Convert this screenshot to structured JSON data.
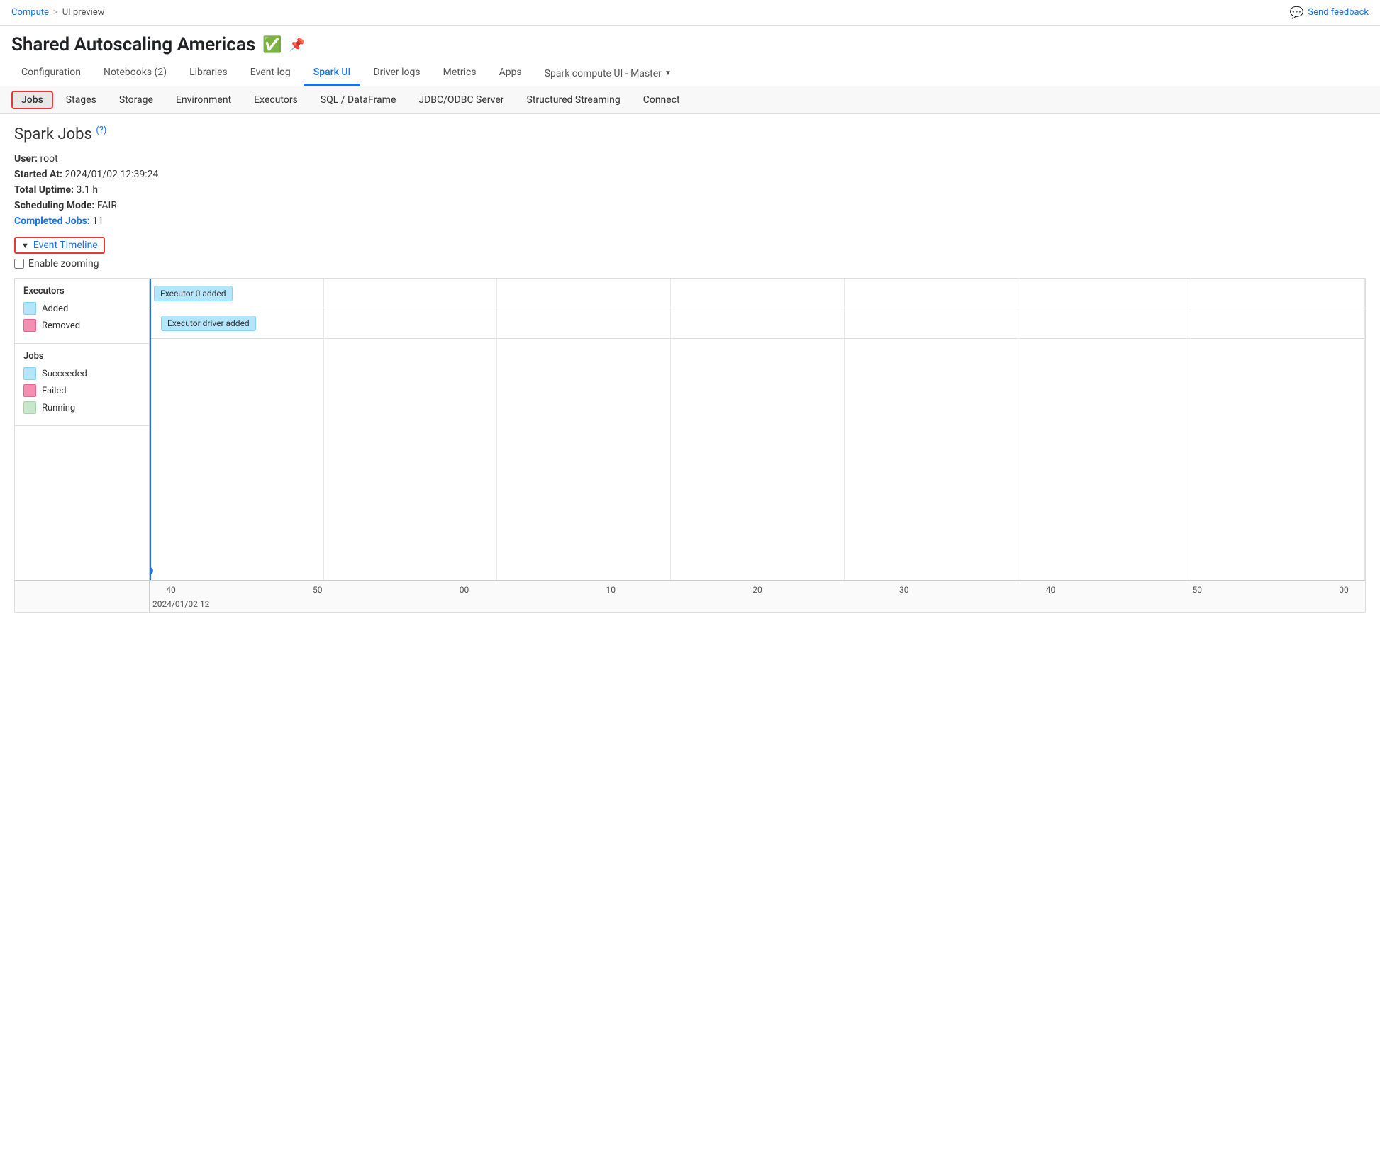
{
  "breadcrumb": {
    "compute_label": "Compute",
    "separator": ">",
    "current_label": "UI preview"
  },
  "feedback": {
    "label": "Send feedback",
    "icon": "💬"
  },
  "page": {
    "title": "Shared Autoscaling Americas",
    "status_icon": "✅",
    "pin_icon": "📌"
  },
  "primary_nav": {
    "tabs": [
      {
        "label": "Configuration",
        "active": false
      },
      {
        "label": "Notebooks (2)",
        "active": false
      },
      {
        "label": "Libraries",
        "active": false
      },
      {
        "label": "Event log",
        "active": false
      },
      {
        "label": "Spark UI",
        "active": true
      },
      {
        "label": "Driver logs",
        "active": false
      },
      {
        "label": "Metrics",
        "active": false
      },
      {
        "label": "Apps",
        "active": false
      }
    ],
    "dropdown_label": "Spark compute UI - Master"
  },
  "secondary_nav": {
    "items": [
      {
        "label": "Jobs",
        "active": true
      },
      {
        "label": "Stages",
        "active": false
      },
      {
        "label": "Storage",
        "active": false
      },
      {
        "label": "Environment",
        "active": false
      },
      {
        "label": "Executors",
        "active": false
      },
      {
        "label": "SQL / DataFrame",
        "active": false
      },
      {
        "label": "JDBC/ODBC Server",
        "active": false
      },
      {
        "label": "Structured Streaming",
        "active": false
      },
      {
        "label": "Connect",
        "active": false
      }
    ]
  },
  "spark_jobs": {
    "title": "Spark Jobs",
    "help_icon": "(?)",
    "user_label": "User:",
    "user_value": "root",
    "started_label": "Started At:",
    "started_value": "2024/01/02 12:39:24",
    "uptime_label": "Total Uptime:",
    "uptime_value": "3.1 h",
    "scheduling_label": "Scheduling Mode:",
    "scheduling_value": "FAIR",
    "completed_jobs_label": "Completed Jobs:",
    "completed_jobs_value": "11"
  },
  "event_timeline": {
    "label": "Event Timeline",
    "enable_zooming_label": "Enable zooming"
  },
  "timeline": {
    "executors_section_title": "Executors",
    "legend_added_label": "Added",
    "legend_removed_label": "Removed",
    "executor_0_badge": "Executor 0 added",
    "executor_driver_badge": "Executor driver added",
    "jobs_section_title": "Jobs",
    "legend_succeeded_label": "Succeeded",
    "legend_failed_label": "Failed",
    "legend_running_label": "Running",
    "axis_ticks": [
      "40",
      "50",
      "00",
      "10",
      "20",
      "30",
      "40",
      "50",
      "00"
    ],
    "axis_date": "2024/01/02 12",
    "colors": {
      "executor_added": "#b3e5fc",
      "executor_removed": "#f48fb1",
      "job_succeeded": "#b3e5fc",
      "job_failed": "#f48fb1",
      "job_running": "#c8e6c9"
    }
  }
}
